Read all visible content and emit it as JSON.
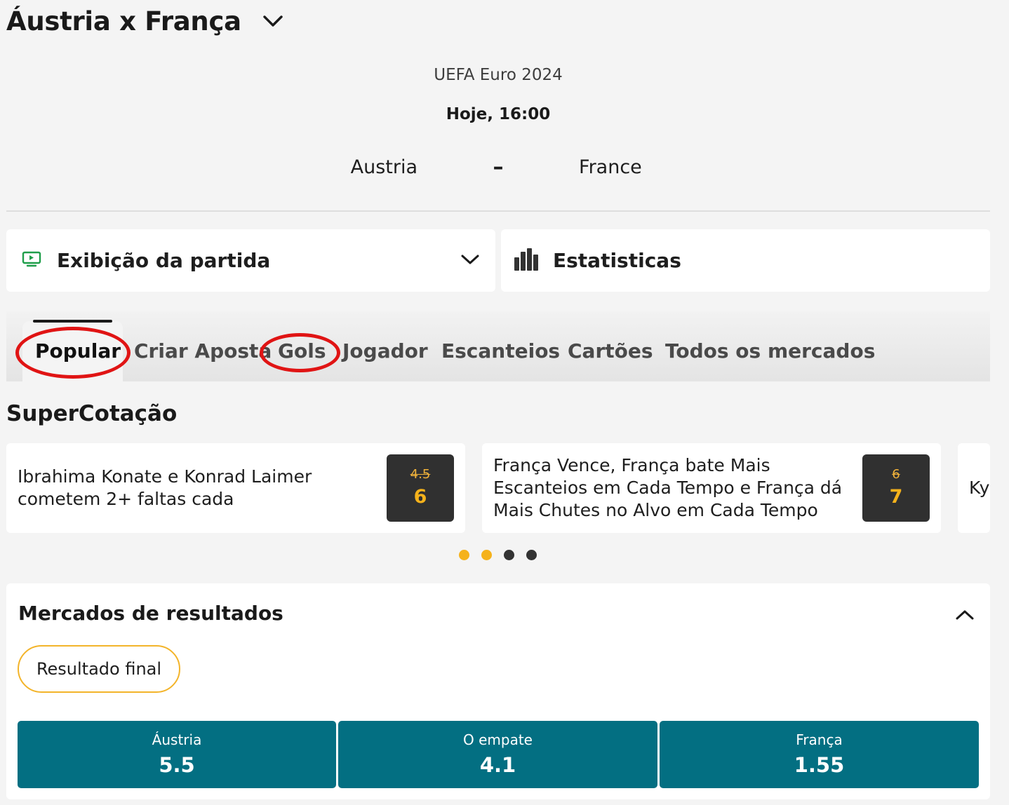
{
  "header": {
    "match_title": "Áustria x França",
    "competition": "UEFA Euro 2024",
    "datetime": "Hoje, 16:00",
    "home_team": "Austria",
    "away_team": "France",
    "score_separator": "–"
  },
  "panels": {
    "match_view": {
      "title": "Exibição da partida",
      "icon": "tv-play-icon"
    },
    "stats": {
      "title": "Estatisticas",
      "icon": "bar-chart-icon"
    }
  },
  "tabs": [
    {
      "label": "Popular",
      "active": true
    },
    {
      "label": "Criar Aposta",
      "active": false
    },
    {
      "label": "Gols",
      "active": false
    },
    {
      "label": "Jogador",
      "active": false
    },
    {
      "label": "Escanteios",
      "active": false
    },
    {
      "label": "Cartões",
      "active": false
    },
    {
      "label": "Todos os mercados",
      "active": false
    }
  ],
  "super_cotacao": {
    "title": "SuperCotação",
    "offers": [
      {
        "text": "Ibrahima Konate e Konrad Laimer cometem 2+ faltas cada",
        "old_odds": "4.5",
        "new_odds": "6"
      },
      {
        "text": "França Vence, França bate Mais Escanteios em Cada Tempo e França dá Mais Chutes no Alvo em Cada Tempo",
        "old_odds": "6",
        "new_odds": "7"
      },
      {
        "text": "Ky"
      }
    ],
    "pagination": {
      "total": 4,
      "highlighted": [
        0,
        1
      ]
    }
  },
  "markets": {
    "title": "Mercados de resultados",
    "filter_label": "Resultado final",
    "outcomes": [
      {
        "label": "Áustria",
        "odds": "5.5"
      },
      {
        "label": "O empate",
        "odds": "4.1"
      },
      {
        "label": "França",
        "odds": "1.55"
      }
    ]
  },
  "colors": {
    "accent": "#f5b21b",
    "outcome_bg": "#036f82",
    "annotation_ring": "#e01414",
    "tv_icon": "#1f9e4a"
  }
}
